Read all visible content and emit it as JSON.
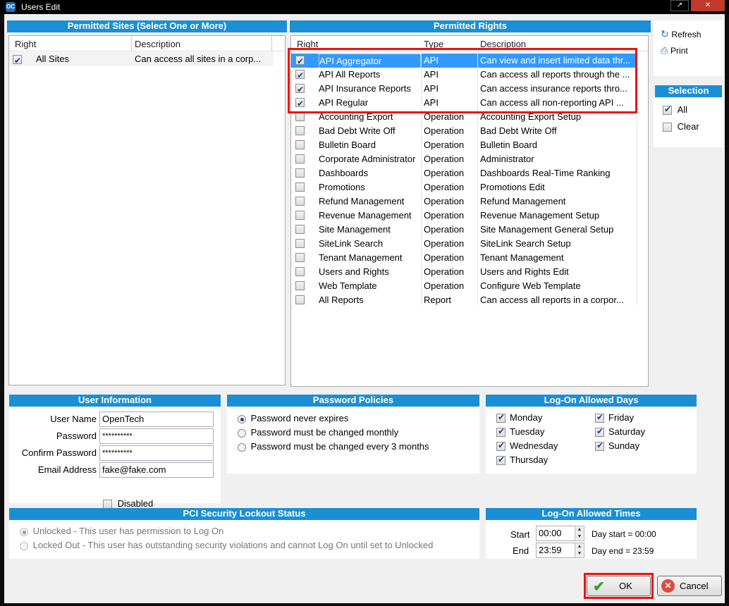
{
  "window": {
    "title": "Users Edit",
    "logo": "OC"
  },
  "sites": {
    "header": "Permitted Sites (Select One or More)",
    "columns": {
      "right": "Right",
      "description": "Description"
    },
    "rows": [
      {
        "checked": true,
        "right": "All Sites",
        "description": "Can access all sites in a corp..."
      }
    ]
  },
  "rights": {
    "header": "Permitted Rights",
    "columns": {
      "right": "Right",
      "type": "Type",
      "description": "Description"
    },
    "rows": [
      {
        "checked": true,
        "right": "API Aggregator",
        "type": "API",
        "description": "Can view and insert limited data thr...",
        "selected": true
      },
      {
        "checked": true,
        "right": "API All Reports",
        "type": "API",
        "description": "Can access all reports through the ..."
      },
      {
        "checked": true,
        "right": "API Insurance Reports",
        "type": "API",
        "description": "Can access insurance reports thro..."
      },
      {
        "checked": true,
        "right": "API Regular",
        "type": "API",
        "description": "Can access all non-reporting API ..."
      },
      {
        "checked": false,
        "right": "Accounting Export",
        "type": "Operation",
        "description": "Accounting Export Setup"
      },
      {
        "checked": false,
        "right": "Bad Debt Write Off",
        "type": "Operation",
        "description": "Bad Debt Write Off"
      },
      {
        "checked": false,
        "right": "Bulletin Board",
        "type": "Operation",
        "description": "Bulletin Board"
      },
      {
        "checked": false,
        "right": "Corporate Administrator",
        "type": "Operation",
        "description": "Administrator"
      },
      {
        "checked": false,
        "right": "Dashboards",
        "type": "Operation",
        "description": "Dashboards Real-Time Ranking"
      },
      {
        "checked": false,
        "right": "Promotions",
        "type": "Operation",
        "description": "Promotions Edit"
      },
      {
        "checked": false,
        "right": "Refund Management",
        "type": "Operation",
        "description": "Refund Management"
      },
      {
        "checked": false,
        "right": "Revenue Management",
        "type": "Operation",
        "description": "Revenue Management Setup"
      },
      {
        "checked": false,
        "right": "Site Management",
        "type": "Operation",
        "description": "Site Management General Setup"
      },
      {
        "checked": false,
        "right": "SiteLink Search",
        "type": "Operation",
        "description": "SiteLink Search Setup"
      },
      {
        "checked": false,
        "right": "Tenant Management",
        "type": "Operation",
        "description": "Tenant Management"
      },
      {
        "checked": false,
        "right": "Users and Rights",
        "type": "Operation",
        "description": "Users and Rights Edit"
      },
      {
        "checked": false,
        "right": "Web Template",
        "type": "Operation",
        "description": "Configure Web Template"
      },
      {
        "checked": false,
        "right": "All Reports",
        "type": "Report",
        "description": "Can access all reports in a corpor..."
      }
    ]
  },
  "toolbar": {
    "refresh": "Refresh",
    "print": "Print",
    "refresh_icon": "refresh-icon",
    "print_icon": "printer-icon"
  },
  "selection": {
    "header": "Selection",
    "all": "All",
    "all_checked": true,
    "clear": "Clear",
    "clear_checked": false
  },
  "user_info": {
    "header": "User Information",
    "username_label": "User Name",
    "username": "OpenTech",
    "password_label": "Password",
    "password": "**********",
    "confirm_label": "Confirm Password",
    "confirm": "**********",
    "email_label": "Email Address",
    "email": "fake@fake.com",
    "disabled_label": "Disabled",
    "disabled": false
  },
  "password_policies": {
    "header": "Password Policies",
    "options": [
      {
        "label": "Password never expires",
        "selected": true
      },
      {
        "label": "Password must be changed monthly",
        "selected": false
      },
      {
        "label": "Password must be changed every 3 months",
        "selected": false
      }
    ]
  },
  "logon_days": {
    "header": "Log-On Allowed Days",
    "days": [
      {
        "label": "Monday",
        "checked": true
      },
      {
        "label": "Tuesday",
        "checked": true
      },
      {
        "label": "Wednesday",
        "checked": true
      },
      {
        "label": "Thursday",
        "checked": true
      },
      {
        "label": "Friday",
        "checked": true
      },
      {
        "label": "Saturday",
        "checked": true
      },
      {
        "label": "Sunday",
        "checked": true
      }
    ]
  },
  "pci": {
    "header": "PCI Security Lockout Status",
    "unlocked": "Unlocked - This user has permission to Log On",
    "locked": "Locked Out - This user has outstanding security violations and cannot Log On until set to Unlocked"
  },
  "logon_times": {
    "header": "Log-On Allowed Times",
    "start_label": "Start",
    "start": "00:00",
    "start_note": "Day start = 00:00",
    "end_label": "End",
    "end": "23:59",
    "end_note": "Day end = 23:59"
  },
  "buttons": {
    "ok": "OK",
    "cancel": "Cancel",
    "ok_icon": "checkmark-icon",
    "cancel_icon": "cancel-icon"
  },
  "colors": {
    "header_blue": "#1a8fd6",
    "highlight_red": "#e11111",
    "selection_blue": "#3399ff"
  }
}
